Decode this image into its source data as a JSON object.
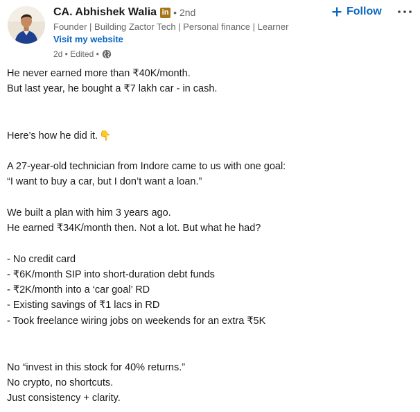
{
  "author": {
    "name": "CA. Abhishek Walia",
    "badge": "in",
    "separator": "•",
    "degree": "2nd",
    "headline": "Founder | Building Zactor Tech | Personal finance | Learner",
    "website_label": "Visit my website",
    "post_meta": "2d • Edited •"
  },
  "actions": {
    "follow_label": "Follow",
    "more_label": "···"
  },
  "post": {
    "lines": [
      "He never earned more than ₹40K/month.",
      "But last year, he bought a ₹7 lakh car - in cash.",
      "Here’s how he did it.",
      "A 27-year-old technician from Indore came to us with one goal:",
      "“I want to buy a car, but I don’t want a loan.”",
      "We built a plan with him 3 years ago.",
      "He earned ₹34K/month then. Not a lot. But what he had?",
      "- No credit card",
      "- ₹6K/month SIP into short-duration debt funds",
      "- ₹2K/month into a ‘car goal’ RD",
      "- Existing savings of ₹1 lacs in RD",
      "- Took freelance wiring jobs on weekends for an extra ₹5K",
      "No “invest in this stock for 40% returns.”",
      "No crypto, no shortcuts.",
      "Just consistency + clarity."
    ],
    "emoji": "👇"
  },
  "colors": {
    "link_blue": "#0a66c2",
    "muted_text": "#666666",
    "body_text": "#191919",
    "premium_badge": "#a8741a"
  },
  "icons": [
    "avatar-photo",
    "premium-in-badge",
    "globe-icon",
    "plus-icon",
    "more-dots-icon",
    "pointing-down-hand-icon"
  ]
}
